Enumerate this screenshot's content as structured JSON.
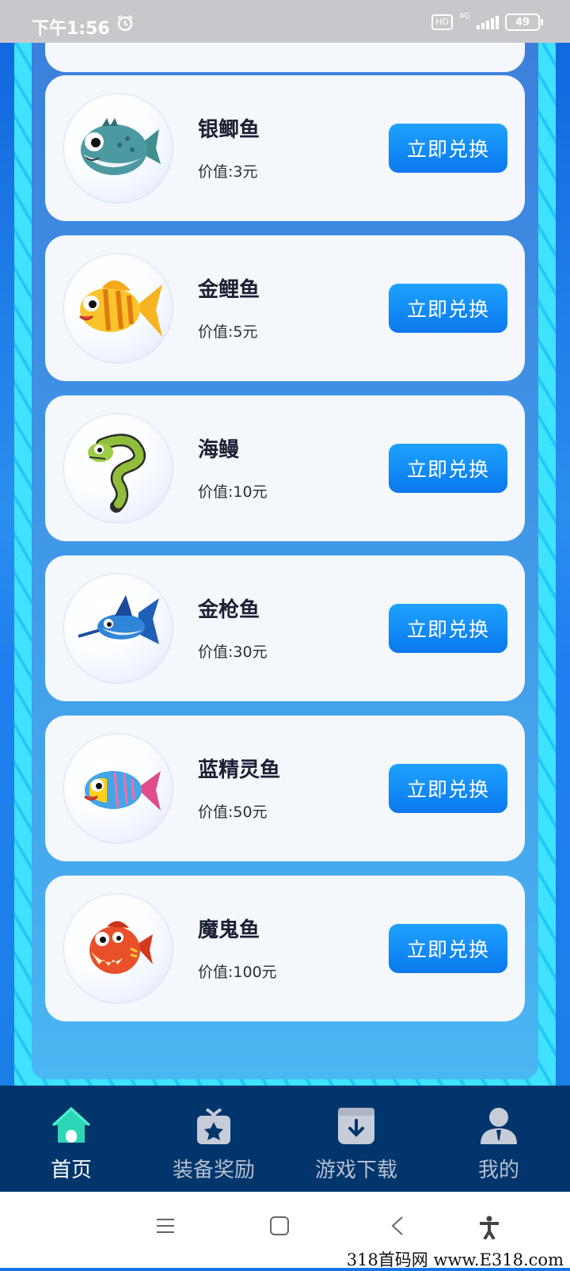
{
  "status_bar": {
    "time": "下午1:56",
    "hd": "HD",
    "network": "4G",
    "battery": "49"
  },
  "fish_list": [
    {
      "name": "银鲫鱼",
      "value": "价值:3元",
      "button": "立即兑换",
      "icon": "pufferfish-icon"
    },
    {
      "name": "金鲤鱼",
      "value": "价值:5元",
      "button": "立即兑换",
      "icon": "goldfish-icon"
    },
    {
      "name": "海鳗",
      "value": "价值:10元",
      "button": "立即兑换",
      "icon": "eel-icon"
    },
    {
      "name": "金枪鱼",
      "value": "价值:30元",
      "button": "立即兑换",
      "icon": "swordfish-icon"
    },
    {
      "name": "蓝精灵鱼",
      "value": "价值:50元",
      "button": "立即兑换",
      "icon": "blue-fish-icon"
    },
    {
      "name": "魔鬼鱼",
      "value": "价值:100元",
      "button": "立即兑换",
      "icon": "piranha-icon"
    }
  ],
  "tabs": [
    {
      "label": "首页",
      "icon": "home-icon",
      "active": true
    },
    {
      "label": "装备奖励",
      "icon": "gift-star-icon",
      "active": false
    },
    {
      "label": "游戏下载",
      "icon": "download-box-icon",
      "active": false
    },
    {
      "label": "我的",
      "icon": "user-icon",
      "active": false
    }
  ],
  "colors": {
    "accent": "#0a78ee",
    "tab_bar": "#02356c",
    "frame": "#3fe3ff",
    "home_icon": "#2ed6b8"
  },
  "watermark": "318首码网 www.E318.com"
}
